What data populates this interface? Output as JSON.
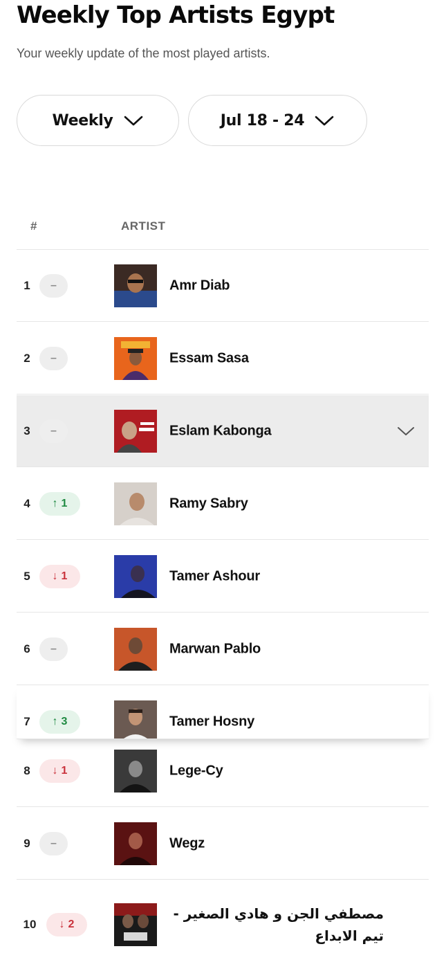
{
  "header": {
    "title": "Weekly Top Artists Egypt",
    "subtitle": "Your weekly update of the most played artists."
  },
  "filters": {
    "period": "Weekly",
    "range": "Jul 18 - 24"
  },
  "table": {
    "headers": {
      "rank": "#",
      "artist": "ARTIST"
    },
    "rows": [
      {
        "rank": "1",
        "change": "same",
        "change_label": "–",
        "name": "Amr Diab",
        "avatar_color": "#2b4a8c"
      },
      {
        "rank": "2",
        "change": "same",
        "change_label": "–",
        "name": "Essam Sasa",
        "avatar_color": "#e8651c"
      },
      {
        "rank": "3",
        "change": "same",
        "change_label": "–",
        "name": "Eslam Kabonga",
        "avatar_color": "#b01c22"
      },
      {
        "rank": "4",
        "change": "up",
        "change_label": "1",
        "name": "Ramy Sabry",
        "avatar_color": "#b9aca2"
      },
      {
        "rank": "5",
        "change": "down",
        "change_label": "1",
        "name": "Tamer Ashour",
        "avatar_color": "#2a3ca8"
      },
      {
        "rank": "6",
        "change": "same",
        "change_label": "–",
        "name": "Marwan Pablo",
        "avatar_color": "#c7562a"
      },
      {
        "rank": "7",
        "change": "up",
        "change_label": "3",
        "name": "Tamer Hosny",
        "avatar_color": "#6b5a52"
      },
      {
        "rank": "8",
        "change": "down",
        "change_label": "1",
        "name": "Lege-Cy",
        "avatar_color": "#3a3a3a"
      },
      {
        "rank": "9",
        "change": "same",
        "change_label": "–",
        "name": "Wegz",
        "avatar_color": "#5a1212"
      },
      {
        "rank": "10",
        "change": "down",
        "change_label": "2",
        "name": "مصطفي الجن و هادي الصغير - تيم الابداع",
        "avatar_color": "#1a1a1a"
      }
    ]
  },
  "colors": {
    "up": "#1f8a42",
    "down": "#c9313b",
    "selected_row": "#ececec"
  },
  "icons": {
    "filter_chevron": "chevron-down-icon",
    "row_expand": "chevron-down-icon"
  }
}
